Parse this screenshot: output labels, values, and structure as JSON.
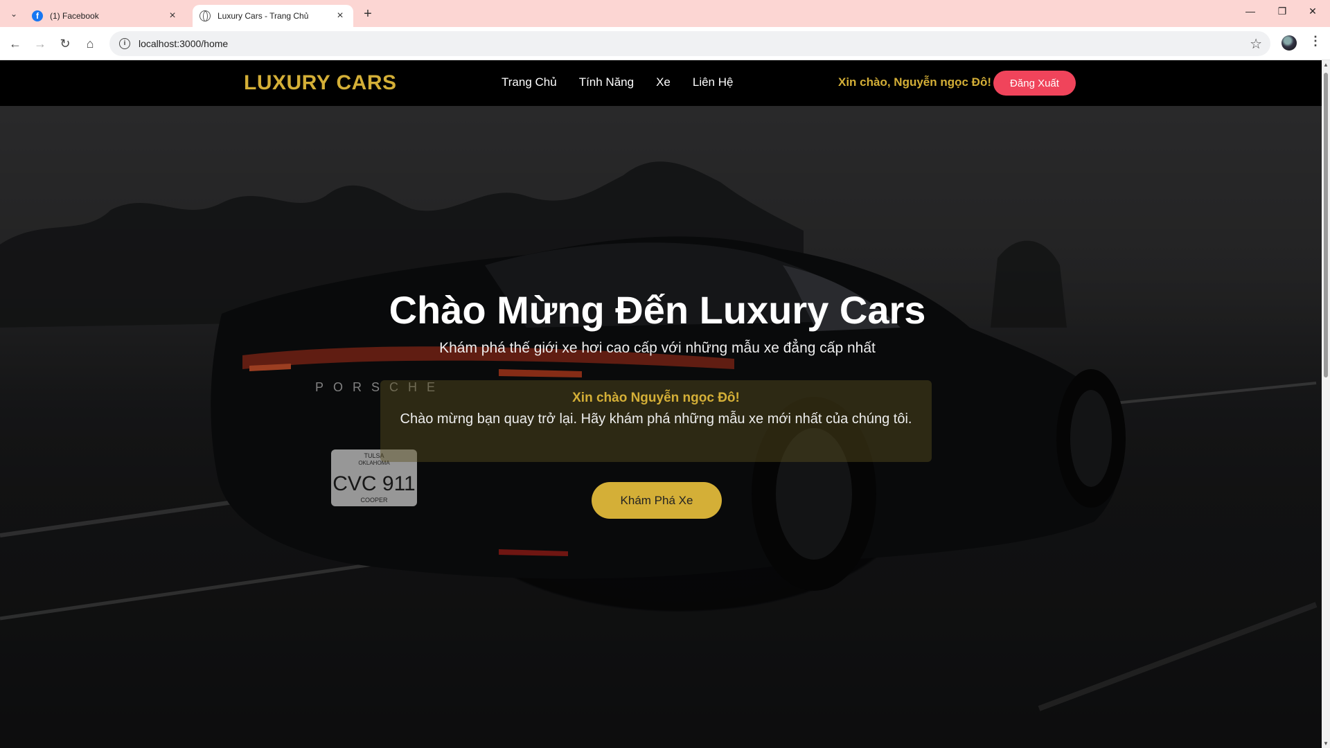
{
  "browser": {
    "tabs": [
      {
        "title": "(1) Facebook",
        "icon": "facebook-icon"
      },
      {
        "title": "Luxury Cars - Trang Chủ",
        "icon": "globe-icon"
      }
    ],
    "url": "localhost:3000/home"
  },
  "nav": {
    "logo": "LUXURY CARS",
    "menu": [
      "Trang Chủ",
      "Tính Năng",
      "Xe",
      "Liên Hệ"
    ],
    "greeting": "Xin chào, Nguyễn ngọc Đô!",
    "logout_label": "Đăng Xuất"
  },
  "hero": {
    "title": "Chào Mừng Đến Luxury Cars",
    "subtitle": "Khám phá thế giới xe hơi cao cấp với những mẫu xe đẳng cấp nhất",
    "welcome_name": "Xin chào Nguyễn ngọc Đô!",
    "welcome_message": "Chào mừng bạn quay trở lại. Hãy khám phá những mẫu xe mới nhất của chúng tôi.",
    "cta_label": "Khám Phá Xe",
    "car_brand_text": "PORSCHE",
    "plate_text": "CVC 911",
    "plate_state": "OKLAHOMA",
    "plate_top": "TULSA",
    "plate_bottom": "COOPER"
  },
  "colors": {
    "gold": "#d4af37",
    "logout": "#f0445b",
    "tabbar": "#fcd6d3"
  }
}
